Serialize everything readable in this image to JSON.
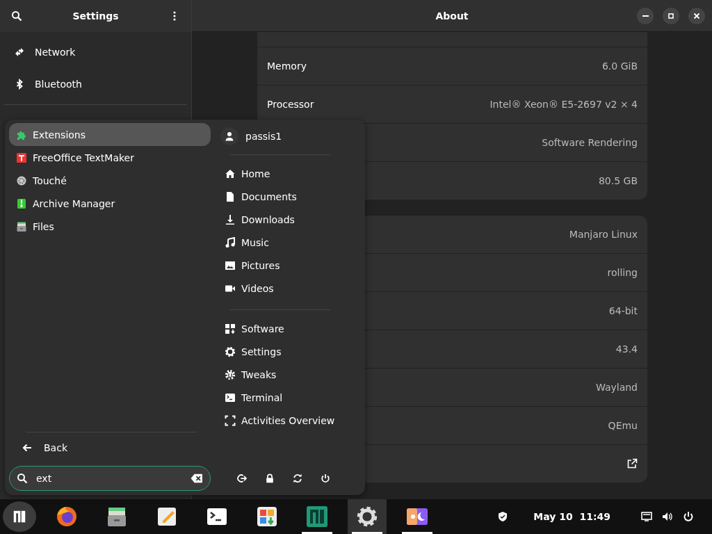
{
  "window": {
    "title": "About",
    "sidebar_title": "Settings"
  },
  "sidebar": {
    "items": [
      {
        "label": "Network",
        "selected": false
      },
      {
        "label": "Bluetooth",
        "selected": false
      }
    ]
  },
  "about": {
    "groups": [
      {
        "rows": [
          {
            "kind": "cut"
          },
          {
            "kind": "info",
            "label": "Memory",
            "value": "6.0 GiB"
          },
          {
            "kind": "info",
            "label": "Processor",
            "value": "Intel® Xeon® E5-2697 v2 × 4"
          },
          {
            "kind": "info",
            "value": "Software Rendering"
          },
          {
            "kind": "info",
            "value": "80.5 GB"
          }
        ]
      },
      {
        "rows": [
          {
            "kind": "info",
            "value": "Manjaro Linux"
          },
          {
            "kind": "info",
            "value": "rolling"
          },
          {
            "kind": "info",
            "value": "64-bit"
          },
          {
            "kind": "info",
            "value": "43.4"
          },
          {
            "kind": "info",
            "value": "Wayland"
          },
          {
            "kind": "info",
            "value": "QEmu"
          },
          {
            "kind": "link"
          }
        ]
      }
    ]
  },
  "menu": {
    "apps": [
      {
        "label": "Extensions",
        "selected": true
      },
      {
        "label": "FreeOffice TextMaker",
        "selected": false
      },
      {
        "label": "Touché",
        "selected": false
      },
      {
        "label": "Archive Manager",
        "selected": false
      },
      {
        "label": "Files",
        "selected": false
      }
    ],
    "user": "passis1",
    "places": [
      "Home",
      "Documents",
      "Downloads",
      "Music",
      "Pictures",
      "Videos"
    ],
    "tools": [
      "Software",
      "Settings",
      "Tweaks",
      "Terminal",
      "Activities Overview"
    ],
    "back": "Back",
    "search": {
      "value": "ext"
    }
  },
  "taskbar": {
    "menu_button": {
      "selected": true
    },
    "apps": [
      {
        "running": false,
        "focused": false
      },
      {
        "running": false,
        "focused": false
      },
      {
        "running": false,
        "focused": false
      },
      {
        "running": false,
        "focused": false
      },
      {
        "running": false,
        "focused": false
      },
      {
        "running": true,
        "focused": false
      },
      {
        "running": true,
        "focused": true
      },
      {
        "running": true,
        "focused": false
      }
    ],
    "clock": "May 10  11:49"
  }
}
